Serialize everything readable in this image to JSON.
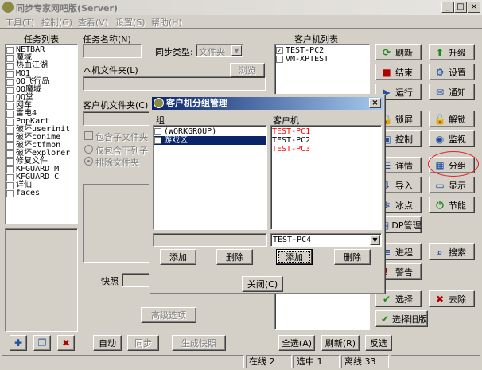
{
  "window": {
    "title": "同步专家网吧版(Server)"
  },
  "menu": [
    "工具(T)",
    "控制(G)",
    "查看(V)",
    "设置(S)",
    "帮助(H)"
  ],
  "task_list": {
    "title": "任务列表",
    "items": [
      "NETBAR",
      "魔域",
      "热血江湖",
      "MO1",
      "QQ飞行岛",
      "QQ魔域",
      "QQ堂",
      "网车",
      "雷电4",
      "PopKart",
      "破坏userinit",
      "破坏conime",
      "破坏ctfmon",
      "破坏explorer",
      "修复文件",
      "KFGUARD_M",
      "KFGUARD_C",
      "详仙",
      "faces"
    ]
  },
  "task_form": {
    "task_name_label": "任务名称(N)",
    "sync_type_label": "同步类型:",
    "sync_type_value": "文件夹",
    "local_folder_label": "本机文件夹(L)",
    "browse_label": "浏览",
    "client_folder_label": "客户机文件夹(C)",
    "include_sub_label": "包含子文件夹(I)",
    "only_include_label": "仅包含下列子目录",
    "exclude_label": "排除文件夹",
    "snapshot_label": "快照",
    "advanced_label": "高级选项"
  },
  "bottom_left": {
    "auto_label": "自动",
    "sync_label": "同步",
    "gen_snapshot_label": "生成快照"
  },
  "client_list": {
    "title": "客户机列表",
    "items": [
      {
        "name": "TEST-PC2",
        "checked": true
      },
      {
        "name": "VM-XPTEST",
        "checked": false
      }
    ],
    "select_all_label": "全选(A)",
    "invert_label": "反选",
    "refresh_select_label": "刷新(R)"
  },
  "right_buttons": [
    {
      "id": "refresh",
      "label": "刷新",
      "icon": "refresh-icon",
      "glyph": "⟳",
      "color": "#1a8a1a"
    },
    {
      "id": "upgrade",
      "label": "升级",
      "icon": "upgrade-icon",
      "glyph": "⬆",
      "color": "#1a8a1a"
    },
    {
      "id": "end",
      "label": "结束",
      "icon": "end-icon",
      "glyph": "■",
      "color": "#b00000"
    },
    {
      "id": "settings",
      "label": "设置",
      "icon": "settings-icon",
      "glyph": "⚙",
      "color": "#2050a0"
    },
    {
      "id": "run",
      "label": "运行",
      "icon": "run-icon",
      "glyph": "▶",
      "color": "#2050a0"
    },
    {
      "id": "notify",
      "label": "通知",
      "icon": "notify-icon",
      "glyph": "✉",
      "color": "#2050a0"
    },
    {
      "id": "lock",
      "label": "锁屏",
      "icon": "lock-icon",
      "glyph": "🔒",
      "color": "#806000"
    },
    {
      "id": "unlock",
      "label": "解锁",
      "icon": "unlock-icon",
      "glyph": "🔓",
      "color": "#806000"
    },
    {
      "id": "control",
      "label": "控制",
      "icon": "control-icon",
      "glyph": "▣",
      "color": "#2050a0"
    },
    {
      "id": "monitor",
      "label": "监视",
      "icon": "monitor-icon",
      "glyph": "◉",
      "color": "#2050a0"
    },
    {
      "id": "details",
      "label": "详情",
      "icon": "details-icon",
      "glyph": "☰",
      "color": "#2050a0"
    },
    {
      "id": "group",
      "label": "分组",
      "icon": "group-icon",
      "glyph": "▦",
      "color": "#2050a0"
    },
    {
      "id": "import",
      "label": "导入",
      "icon": "import-icon",
      "glyph": "⇩",
      "color": "#2050a0"
    },
    {
      "id": "display",
      "label": "显示",
      "icon": "display-icon",
      "glyph": "▭",
      "color": "#2050a0"
    },
    {
      "id": "freeze",
      "label": "冰点",
      "icon": "freeze-icon",
      "glyph": "❄",
      "color": "#2050a0"
    },
    {
      "id": "power",
      "label": "节能",
      "icon": "power-icon",
      "glyph": "⏻",
      "color": "#1a8a1a"
    },
    {
      "id": "dp",
      "label": "DP管理",
      "icon": "dp-icon",
      "glyph": "▤",
      "color": "#2050a0"
    },
    {
      "id": "process",
      "label": "进程",
      "icon": "process-icon",
      "glyph": "≡",
      "color": "#2050a0"
    },
    {
      "id": "search",
      "label": "搜索",
      "icon": "search-icon",
      "glyph": "⌕",
      "color": "#2050a0"
    },
    {
      "id": "alert",
      "label": "警告",
      "icon": "alert-icon",
      "glyph": "!",
      "color": "#b00000"
    },
    {
      "id": "select",
      "label": "选择",
      "icon": "check-icon",
      "glyph": "✔",
      "color": "#1a8a1a"
    },
    {
      "id": "remove",
      "label": "去除",
      "icon": "remove-icon",
      "glyph": "✖",
      "color": "#b00000"
    },
    {
      "id": "select_old",
      "label": "选择旧版",
      "icon": "check-old-icon",
      "glyph": "✔",
      "color": "#1a8a1a"
    }
  ],
  "dialog": {
    "title": "客户机分组管理",
    "group_label": "组",
    "client_label": "客户机",
    "groups": [
      "(WORKGROUP)",
      "游戏区"
    ],
    "clients": [
      {
        "name": "TEST-PC1",
        "color": "#ff0000"
      },
      {
        "name": "TEST-PC2",
        "color": "#000000"
      },
      {
        "name": "TEST-PC3",
        "color": "#ff0000"
      }
    ],
    "client_combo_value": "TEST-PC4",
    "add_group_label": "添加",
    "delete_group_label": "删除",
    "add_client_label": "添加",
    "delete_client_label": "删除",
    "close_label": "关闭(C)"
  },
  "status_bar": {
    "online": "在线 2",
    "selected": "选中 1",
    "offline": "离线 33"
  }
}
